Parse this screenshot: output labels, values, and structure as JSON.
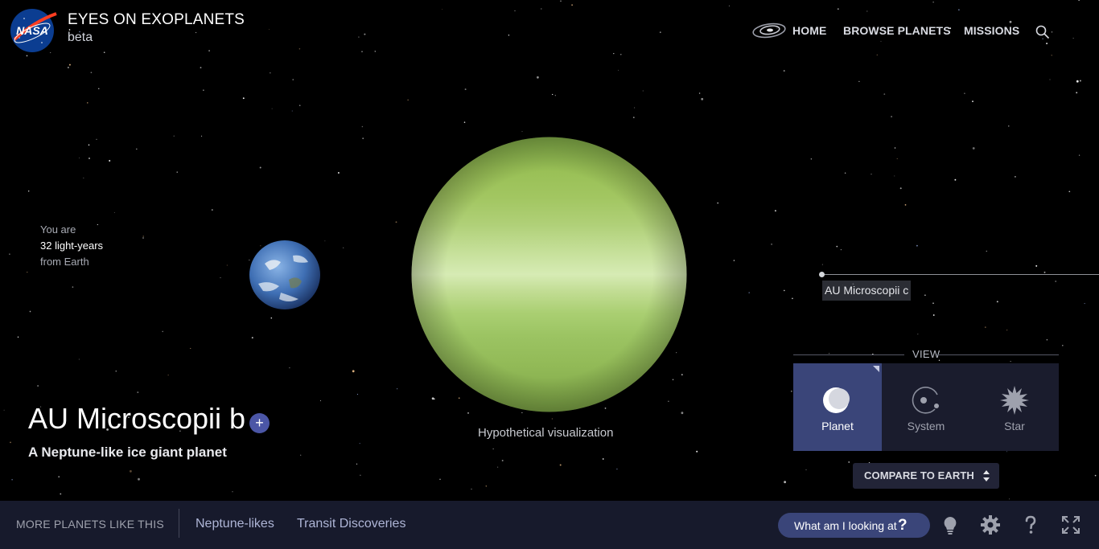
{
  "header": {
    "logo_text": "NASA",
    "title": "EYES ON EXOPLANETS",
    "subtitle": "beta",
    "nav": [
      {
        "label": "HOME"
      },
      {
        "label": "BROWSE PLANETS"
      },
      {
        "label": "MISSIONS"
      }
    ]
  },
  "distance": {
    "line1": "You are",
    "line2": "32 light-years",
    "line3": "from Earth"
  },
  "scene": {
    "caption": "Hypothetical visualization",
    "neighbor_label": "AU Microscopii c"
  },
  "view": {
    "title": "VIEW",
    "options": [
      {
        "label": "Planet",
        "icon": "planet-icon",
        "active": true
      },
      {
        "label": "System",
        "icon": "system-icon",
        "active": false
      },
      {
        "label": "Star",
        "icon": "star-icon",
        "active": false
      }
    ],
    "compare_label": "COMPARE TO EARTH"
  },
  "planet": {
    "name": "AU Microscopii b",
    "description": "A Neptune-like ice giant planet",
    "add_symbol": "+"
  },
  "bottom": {
    "more_label": "MORE PLANETS LIKE THIS",
    "links": [
      "Neptune-likes",
      "Transit Discoveries"
    ],
    "what_label": "What am I looking at",
    "what_symbol": "?"
  },
  "colors": {
    "accent": "#3a4579",
    "panel": "#1a1c2d",
    "bar": "#171a2c",
    "planet_green": "#a8cc66"
  }
}
